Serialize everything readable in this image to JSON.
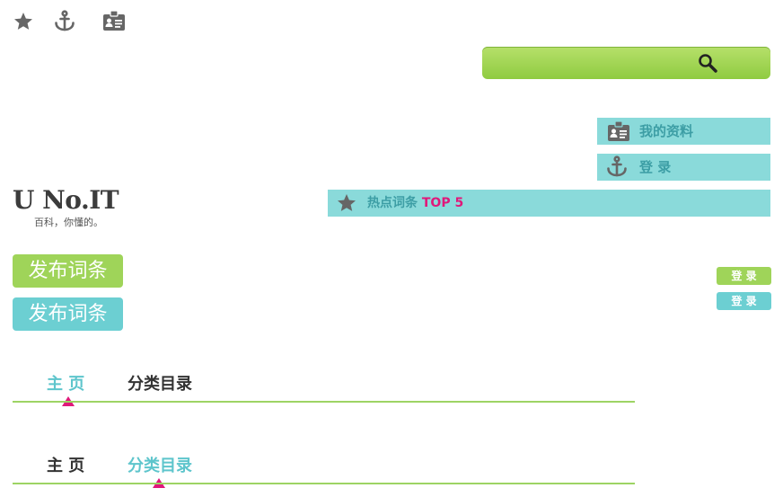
{
  "icons": {
    "star": "star-icon",
    "anchor": "anchor-icon",
    "id_card": "id-card-icon",
    "search": "search-icon"
  },
  "account_links": {
    "profile_label": "我的资料",
    "login_label": "登 录"
  },
  "hot_terms": {
    "label_prefix": "热点词条",
    "label_top": "TOP 5"
  },
  "brand": {
    "logo_text": "U No.IT",
    "tagline": "百科，你懂的。"
  },
  "buttons": {
    "publish_green": "发布词条",
    "publish_teal": "发布词条",
    "login_green": "登 录",
    "login_teal": "登 录"
  },
  "nav_a": {
    "tabs": [
      "主 页",
      "分类目录"
    ],
    "active": 0
  },
  "nav_b": {
    "tabs": [
      "主 页",
      "分类目录"
    ],
    "active": 1
  },
  "colors": {
    "green": "#9fd459",
    "teal": "#6ccfd2",
    "teal_text": "#5ec5cc",
    "pink": "#e0187a",
    "dark_text": "#333333"
  }
}
